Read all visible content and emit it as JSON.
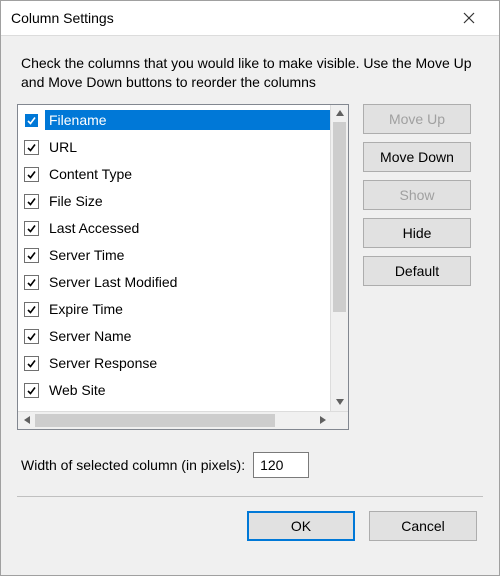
{
  "titlebar": {
    "title": "Column Settings"
  },
  "instructions": "Check the columns that you would like to make visible. Use the Move Up and Move Down buttons to reorder the columns",
  "columns": [
    {
      "label": "Filename",
      "checked": true,
      "selected": true
    },
    {
      "label": "URL",
      "checked": true,
      "selected": false
    },
    {
      "label": "Content Type",
      "checked": true,
      "selected": false
    },
    {
      "label": "File Size",
      "checked": true,
      "selected": false
    },
    {
      "label": "Last Accessed",
      "checked": true,
      "selected": false
    },
    {
      "label": "Server Time",
      "checked": true,
      "selected": false
    },
    {
      "label": "Server Last Modified",
      "checked": true,
      "selected": false
    },
    {
      "label": "Expire Time",
      "checked": true,
      "selected": false
    },
    {
      "label": "Server Name",
      "checked": true,
      "selected": false
    },
    {
      "label": "Server Response",
      "checked": true,
      "selected": false
    },
    {
      "label": "Web Site",
      "checked": true,
      "selected": false
    }
  ],
  "side_buttons": {
    "move_up": {
      "label": "Move Up",
      "enabled": false
    },
    "move_down": {
      "label": "Move Down",
      "enabled": true
    },
    "show": {
      "label": "Show",
      "enabled": false
    },
    "hide": {
      "label": "Hide",
      "enabled": true
    },
    "default": {
      "label": "Default",
      "enabled": true
    }
  },
  "width_row": {
    "label": "Width of selected column (in pixels):",
    "value": "120"
  },
  "footer": {
    "ok": "OK",
    "cancel": "Cancel"
  }
}
